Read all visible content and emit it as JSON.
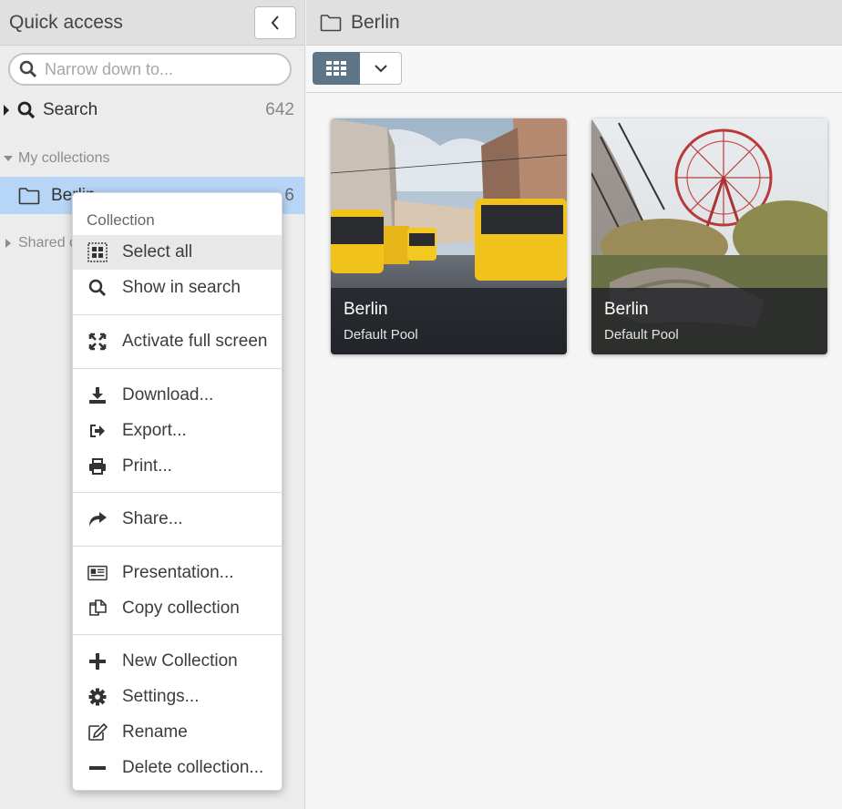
{
  "sidebar": {
    "title": "Quick access",
    "filter_placeholder": "Narrow down to...",
    "search_item": {
      "label": "Search",
      "count": "642"
    },
    "my_collections_label": "My collections",
    "collection_item": {
      "label": "Berlin",
      "count": "6"
    },
    "shared_label": "Shared collections"
  },
  "main": {
    "title": "Berlin",
    "cards": [
      {
        "title": "Berlin",
        "subtitle": "Default Pool"
      },
      {
        "title": "Berlin",
        "subtitle": "Default Pool"
      }
    ]
  },
  "context_menu": {
    "heading": "Collection",
    "items": {
      "select_all": "Select all",
      "show_in_search": "Show in search",
      "fullscreen": "Activate full screen",
      "download": "Download...",
      "export": "Export...",
      "print": "Print...",
      "share": "Share...",
      "presentation": "Presentation...",
      "copy": "Copy collection",
      "new": "New Collection",
      "settings": "Settings...",
      "rename": "Rename",
      "delete": "Delete collection..."
    }
  },
  "colors": {
    "selected_row": "#b7d6f7",
    "grid_button": "#5e7587",
    "header_bg": "#e0e0e0"
  }
}
